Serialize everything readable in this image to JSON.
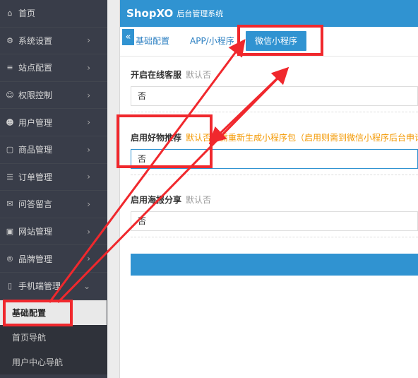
{
  "sidebar": {
    "items": [
      {
        "label": "首页",
        "icon": "home-icon",
        "glyph": "⌂",
        "has_arrow": false
      },
      {
        "label": "系统设置",
        "icon": "gear-icon",
        "glyph": "⚙",
        "has_arrow": true
      },
      {
        "label": "站点配置",
        "icon": "sliders-icon",
        "glyph": "≡",
        "has_arrow": true
      },
      {
        "label": "权限控制",
        "icon": "user-lock-icon",
        "glyph": "☺",
        "has_arrow": true
      },
      {
        "label": "用户管理",
        "icon": "users-icon",
        "glyph": "☻",
        "has_arrow": true
      },
      {
        "label": "商品管理",
        "icon": "goods-icon",
        "glyph": "▢",
        "has_arrow": true
      },
      {
        "label": "订单管理",
        "icon": "order-icon",
        "glyph": "☰",
        "has_arrow": true
      },
      {
        "label": "问答留言",
        "icon": "message-icon",
        "glyph": "✉",
        "has_arrow": true
      },
      {
        "label": "网站管理",
        "icon": "website-icon",
        "glyph": "▣",
        "has_arrow": true
      },
      {
        "label": "品牌管理",
        "icon": "brand-icon",
        "glyph": "®",
        "has_arrow": true
      },
      {
        "label": "手机端管理",
        "icon": "mobile-icon",
        "glyph": "▯",
        "has_arrow": true,
        "expanded": true
      }
    ],
    "subitems": [
      {
        "label": "基础配置",
        "active": true
      },
      {
        "label": "首页导航",
        "active": false
      },
      {
        "label": "用户中心导航",
        "active": false
      }
    ],
    "arrow_right": "›",
    "arrow_down": "⌄"
  },
  "header": {
    "brand": "ShopXO",
    "subtitle": "后台管理系统"
  },
  "tabs": {
    "collapse_glyph": "«",
    "items": [
      {
        "label": "基础配置",
        "active": false
      },
      {
        "label": "APP/小程序",
        "active": false
      },
      {
        "label": "微信小程序",
        "active": true
      }
    ]
  },
  "form": {
    "fields": [
      {
        "label": "开启在线客服",
        "hint": "默认否",
        "hint_type": "normal",
        "value": "否"
      },
      {
        "label": "启用好物推荐",
        "hint": "默认否，需重新生成小程序包（启用则需到微信小程序后台申请",
        "hint_type": "warn",
        "value": "否"
      },
      {
        "label": "启用海报分享",
        "hint": "默认否",
        "hint_type": "normal",
        "value": "否"
      }
    ]
  },
  "annotation": {
    "color": "#f0282d"
  }
}
